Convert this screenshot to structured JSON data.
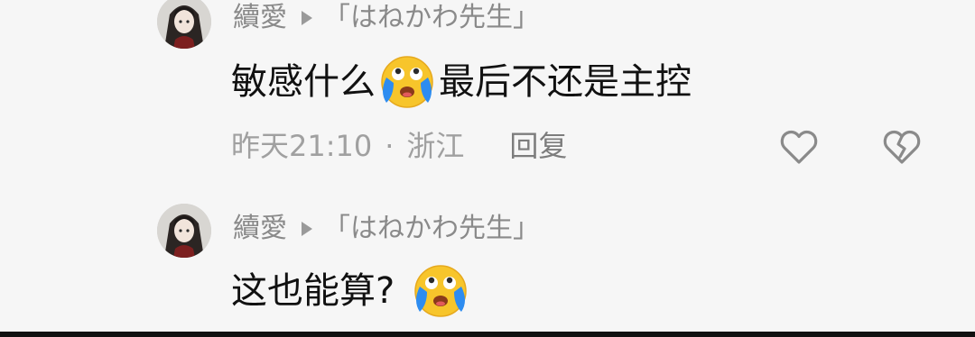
{
  "comments": [
    {
      "author": "續愛",
      "reply_to": "「はねかわ先生」",
      "text_before_emoji": "敏感什么",
      "emoji": "crying-face-emoji",
      "text_after_emoji": "最后不还是主控",
      "time": "昨天21:10",
      "separator": "·",
      "location": "浙江",
      "reply_label": "回复"
    },
    {
      "author": "續愛",
      "reply_to": "「はねかわ先生」",
      "text_before_emoji": "这也能算?",
      "emoji": "crying-face-emoji",
      "text_after_emoji": ""
    }
  ],
  "icons": {
    "like": "heart-outline-icon",
    "dislike": "broken-heart-icon"
  },
  "colors": {
    "background": "#f6f6f6",
    "text": "#111111",
    "muted": "#8a8a8a",
    "emoji_yellow": "#f7c52b",
    "tear_blue": "#2d8cf0"
  }
}
